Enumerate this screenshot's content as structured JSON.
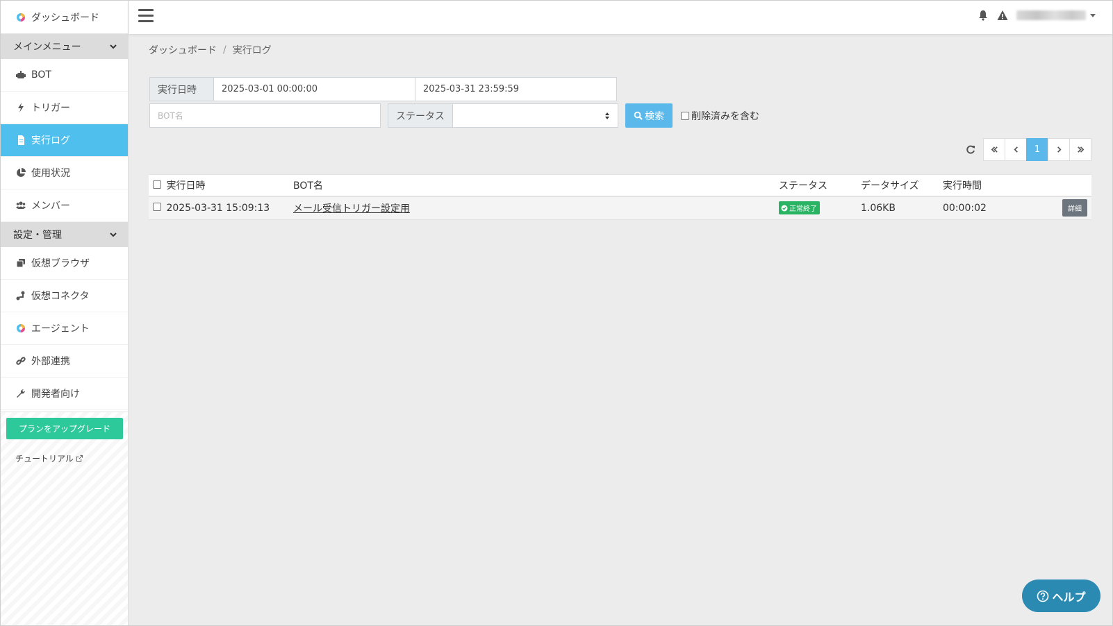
{
  "sidebar": {
    "brand": "ダッシュボード",
    "sections": {
      "main_menu": "メインメニュー",
      "settings": "設定・管理"
    },
    "main_items": [
      {
        "label": "BOT",
        "icon": "robot-icon"
      },
      {
        "label": "トリガー",
        "icon": "bolt-icon"
      },
      {
        "label": "実行ログ",
        "icon": "file-icon"
      },
      {
        "label": "使用状況",
        "icon": "pie-chart-icon"
      },
      {
        "label": "メンバー",
        "icon": "users-icon"
      }
    ],
    "settings_items": [
      {
        "label": "仮想ブラウザ",
        "icon": "browser-icon"
      },
      {
        "label": "仮想コネクタ",
        "icon": "connector-icon"
      },
      {
        "label": "エージェント",
        "icon": "agent-icon"
      },
      {
        "label": "外部連携",
        "icon": "link-icon"
      },
      {
        "label": "開発者向け",
        "icon": "wrench-icon"
      }
    ],
    "upgrade_label": "プランをアップグレード",
    "tutorial_label": "チュートリアル"
  },
  "breadcrumb": {
    "home": "ダッシュボード",
    "sep": "/",
    "current": "実行ログ"
  },
  "filters": {
    "date_label": "実行日時",
    "date_from": "2025-03-01 00:00:00",
    "date_to": "2025-03-31 23:59:59",
    "bot_name_placeholder": "BOT名",
    "status_label": "ステータス",
    "status_value": "",
    "search_label": "検索",
    "include_deleted_label": "削除済みを含む"
  },
  "pagination": {
    "current_page": "1"
  },
  "table": {
    "headers": {
      "executed_at": "実行日時",
      "bot_name": "BOT名",
      "status": "ステータス",
      "data_size": "データサイズ",
      "duration": "実行時間"
    },
    "rows": [
      {
        "executed_at": "2025-03-31 15:09:13",
        "bot_name": "メール受信トリガー設定用",
        "status": "正常終了",
        "data_size": "1.06KB",
        "duration": "00:00:02",
        "detail_label": "詳細"
      }
    ]
  },
  "help_label": "ヘルプ",
  "colors": {
    "accent": "#4fc0ee",
    "upgrade": "#2dc99a",
    "success": "#28b463",
    "help": "#2a8ab2"
  }
}
